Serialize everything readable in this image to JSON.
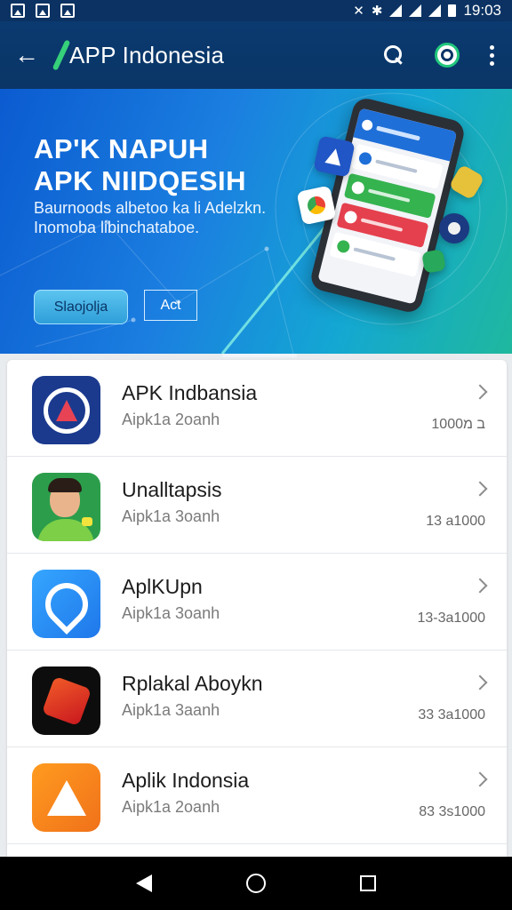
{
  "status_bar": {
    "time": "19:03",
    "icons": [
      "image-icon",
      "image-icon",
      "image-icon",
      "vibrate-icon",
      "bluetooth-icon",
      "wifi-icon",
      "signal-icon",
      "signal-icon",
      "battery-icon"
    ]
  },
  "app_bar": {
    "back_icon": "arrow-left-icon",
    "logo_icon": "app-logo-icon",
    "title": "APP Indonesia",
    "actions": [
      "search-icon",
      "lens-icon",
      "more-vert-icon"
    ]
  },
  "banner": {
    "title_line1": "AP'K NAPUH",
    "title_line2": "APK NIIDQESIH",
    "subtitle_line1": "Baurnoods albetoo ka li Adelzkn.",
    "subtitle_line2": "Inomoba libinchataboe.",
    "primary_button": "Slaojolja",
    "secondary_button": "Act"
  },
  "apps": [
    {
      "name": "APK Indbansia",
      "sub": "Aipk1a 2oanh",
      "meta": "ב מ1000",
      "icon": "compass-logo-icon"
    },
    {
      "name": "Unalltapsis",
      "sub": "Aipk1a 3oanh",
      "meta": "13 a1000",
      "icon": "avatar-icon"
    },
    {
      "name": "AplKUpn",
      "sub": "Aipk1a 3oanh",
      "meta": "13-3a1000",
      "icon": "map-pin-icon"
    },
    {
      "name": "Rplakal Aboykn",
      "sub": "Aipk1a 3aanh",
      "meta": "33 3a1000",
      "icon": "brush-logo-icon"
    },
    {
      "name": "Aplik Indonsia",
      "sub": "Aipk1a 2oanh",
      "meta": "83 3s1000",
      "icon": "drive-logo-icon"
    }
  ],
  "nav_bar": {
    "buttons": [
      "back-nav-icon",
      "home-nav-icon",
      "recents-nav-icon"
    ]
  },
  "colors": {
    "appbar": "#0a3566",
    "accent": "#21c77c",
    "banner_from": "#0b5bd0",
    "banner_to": "#1fb89e"
  }
}
